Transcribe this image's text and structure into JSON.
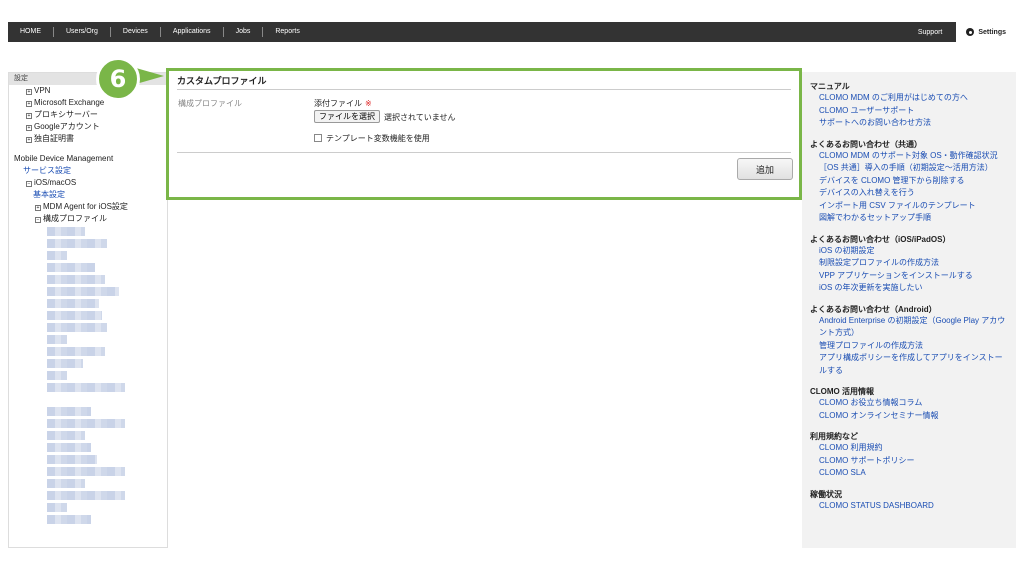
{
  "nav": {
    "items": [
      "HOME",
      "Users/Org",
      "Devices",
      "Applications",
      "Jobs",
      "Reports"
    ],
    "support": "Support",
    "settings": "Settings"
  },
  "sidebar": {
    "header": "設定",
    "tree": [
      {
        "box": "+",
        "label": "VPN"
      },
      {
        "box": "+",
        "label": "Microsoft Exchange"
      },
      {
        "box": "+",
        "label": "プロキシサーバー"
      },
      {
        "box": "+",
        "label": "Googleアカウント"
      },
      {
        "box": "+",
        "label": "独自証明書"
      }
    ],
    "mdm_section": "Mobile Device Management",
    "service_settings": "サービス設定",
    "ios_macos": "iOS/macOS",
    "basic_settings": "基本設定",
    "mdm_agent": "MDM Agent for iOS設定",
    "config_profile": "構成プロファイル",
    "blur_widths": [
      38,
      60,
      20,
      48,
      58,
      72,
      52,
      55,
      60,
      20,
      58,
      36,
      20,
      78,
      0,
      44,
      78,
      38,
      44,
      50,
      78,
      38,
      78,
      20,
      44
    ]
  },
  "main": {
    "title": "カスタムプロファイル",
    "form_label": "構成プロファイル",
    "attach_label": "添付ファイル",
    "required_mark": "※",
    "file_button": "ファイルを選択",
    "file_status": "選択されていません",
    "template_checkbox": "テンプレート変数機能を使用",
    "add_button": "追加"
  },
  "step_badge": "6",
  "help": {
    "sections": [
      {
        "title": "マニュアル",
        "links": [
          "CLOMO MDM のご利用がはじめての方へ",
          "CLOMO ユーザーサポート",
          "サポートへのお問い合わせ方法"
        ]
      },
      {
        "title": "よくあるお問い合わせ（共通）",
        "links": [
          "CLOMO MDM のサポート対象 OS・動作確認状況",
          "［OS 共通］導入の手順（初期設定〜活用方法）",
          "デバイスを CLOMO 管理下から削除する",
          "デバイスの入れ替えを行う",
          "インポート用 CSV ファイルのテンプレート",
          "図解でわかるセットアップ手順"
        ]
      },
      {
        "title": "よくあるお問い合わせ（iOS/iPadOS）",
        "links": [
          "iOS の初期設定",
          "制限設定プロファイルの作成方法",
          "VPP アプリケーションをインストールする",
          "iOS の年次更新を実施したい"
        ]
      },
      {
        "title": "よくあるお問い合わせ（Android）",
        "links": [
          "Android Enterprise の初期設定（Google Play アカウント方式）",
          "管理プロファイルの作成方法",
          "アプリ構成ポリシーを作成してアプリをインストールする"
        ]
      },
      {
        "title": "CLOMO 活用情報",
        "links": [
          "CLOMO お役立ち情報コラム",
          "CLOMO オンラインセミナー情報"
        ]
      },
      {
        "title": "利用規約など",
        "links": [
          "CLOMO 利用規約",
          "CLOMO サポートポリシー",
          "CLOMO SLA"
        ]
      },
      {
        "title": "稼働状況",
        "links": [
          "CLOMO STATUS DASHBOARD"
        ]
      }
    ]
  },
  "colors": {
    "highlight": "#7ab648",
    "link": "#1a4db3",
    "nav": "#333333"
  }
}
